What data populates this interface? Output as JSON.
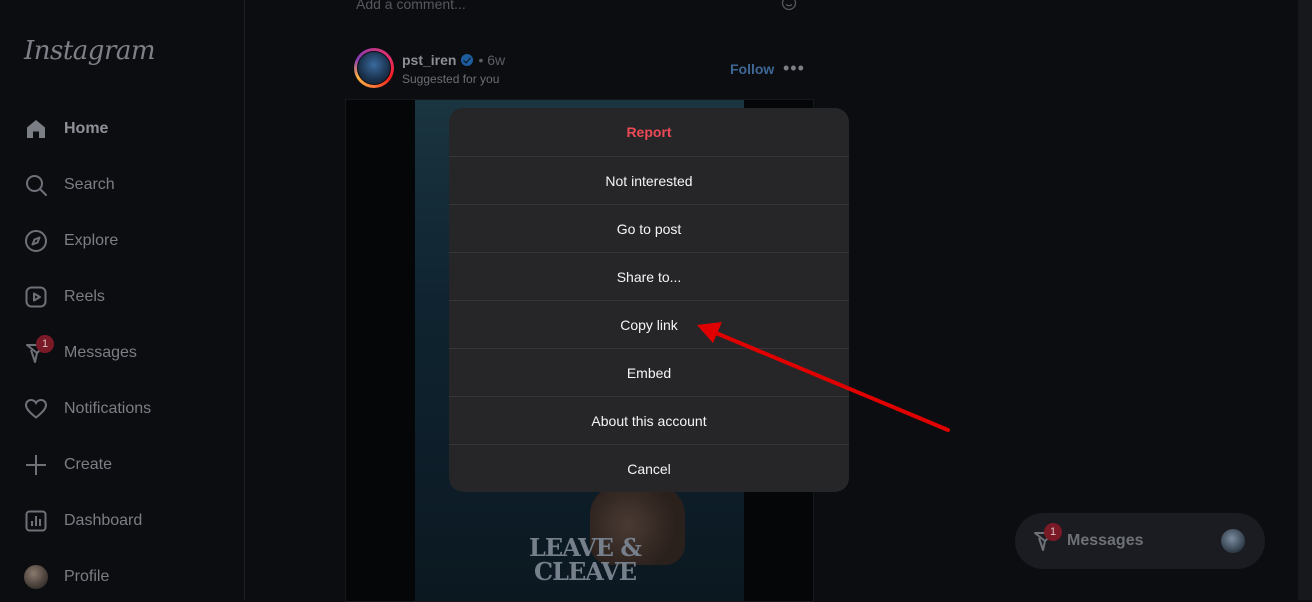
{
  "app": {
    "logo_text": "Instagram"
  },
  "sidebar": {
    "items": [
      {
        "label": "Home",
        "icon": "home-icon"
      },
      {
        "label": "Search",
        "icon": "search-icon"
      },
      {
        "label": "Explore",
        "icon": "compass-icon"
      },
      {
        "label": "Reels",
        "icon": "reels-icon"
      },
      {
        "label": "Messages",
        "icon": "messenger-icon",
        "badge": "1"
      },
      {
        "label": "Notifications",
        "icon": "heart-icon"
      },
      {
        "label": "Create",
        "icon": "plus-icon"
      },
      {
        "label": "Dashboard",
        "icon": "dashboard-icon"
      },
      {
        "label": "Profile",
        "icon": "avatar"
      }
    ]
  },
  "feed": {
    "comment_placeholder": "Add a comment...",
    "post": {
      "username": "pst_iren",
      "time": "• 6w",
      "subtitle": "Suggested for you",
      "follow_label": "Follow",
      "more_label": "•••",
      "image_text": "LEAVE &\nCLEAVE"
    }
  },
  "menu": {
    "items": [
      {
        "label": "Report",
        "style": "danger"
      },
      {
        "label": "Not interested"
      },
      {
        "label": "Go to post"
      },
      {
        "label": "Share to..."
      },
      {
        "label": "Copy link"
      },
      {
        "label": "Embed"
      },
      {
        "label": "About this account"
      },
      {
        "label": "Cancel"
      }
    ]
  },
  "messages_pill": {
    "label": "Messages",
    "badge": "1"
  },
  "colors": {
    "danger": "#ed4956",
    "link": "#0095f6",
    "annotation_arrow": "#e00000"
  }
}
